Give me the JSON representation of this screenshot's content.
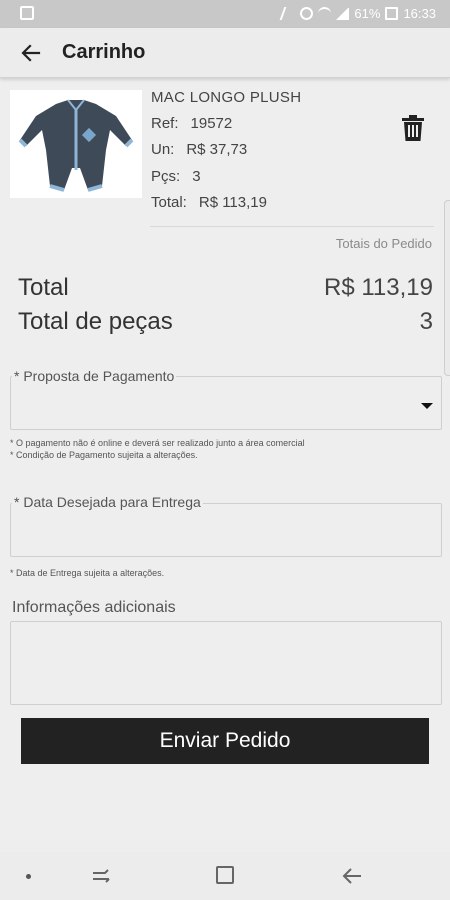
{
  "status_bar": {
    "battery": "61%",
    "time": "16:33"
  },
  "app_bar": {
    "title": "Carrinho",
    "back_icon": "arrow-left-icon"
  },
  "product": {
    "name": "MAC LONGO PLUSH",
    "ref_label": "Ref:",
    "ref_value": "19572",
    "un_label": "Un:",
    "un_value": "R$ 37,73",
    "pcs_label": "Pçs:",
    "pcs_value": "3",
    "total_label": "Total:",
    "total_value": "R$ 113,19",
    "image_icon": "baby-romper-image",
    "delete_icon": "trash-icon"
  },
  "totals": {
    "section_label": "Totais do Pedido",
    "total_label": "Total",
    "total_value": "R$ 113,19",
    "pieces_label": "Total de peças",
    "pieces_value": "3"
  },
  "payment": {
    "label": "* Proposta de Pagamento",
    "value": "",
    "note_1": "* O pagamento não é online e deverá ser realizado junto a área comercial",
    "note_2": "* Condição de Pagamento sujeita a alterações."
  },
  "delivery": {
    "label": "* Data Desejada para Entrega",
    "value": "",
    "note": "* Data de Entrega sujeita a alterações."
  },
  "additional": {
    "label": "Informações adicionais",
    "value": ""
  },
  "submit": {
    "label": "Enviar Pedido"
  },
  "colors": {
    "background": "#eeeeee",
    "status_bar": "#c8c8c8",
    "button": "#222222",
    "text": "#222222",
    "muted": "#8a8a8a"
  }
}
